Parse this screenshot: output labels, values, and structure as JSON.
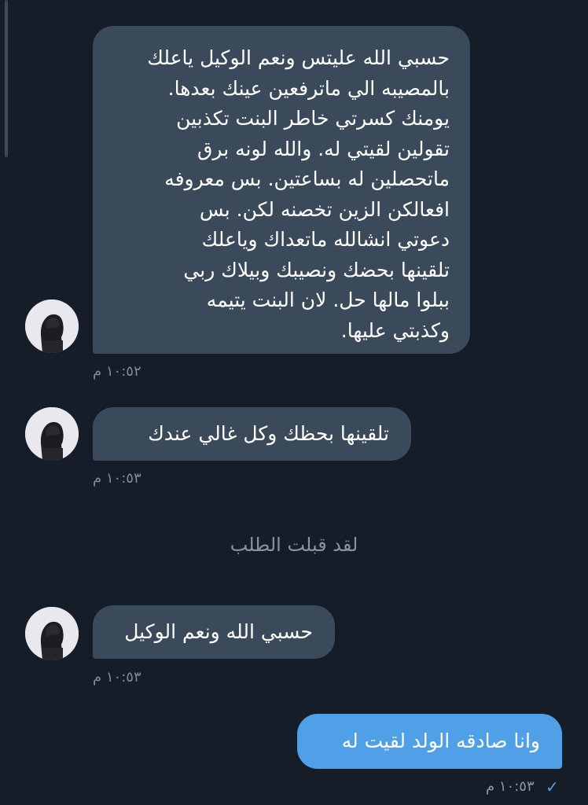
{
  "messages": [
    {
      "direction": "incoming",
      "lines": [
        "حسبي الله عليتس ونعم الوكيل ياعلك",
        "بالمصيبه الي ماترفعين عينك بعدها.",
        "يومنك كسرتي خاطر البنت تكذبين",
        "تقولين لقيتي له. والله لونه برق",
        "ماتحصلين له بساعتين. بس معروفه",
        "افعالكن الزين تخصنه لكن. بس",
        "دعوتي انشالله ماتعداك وياعلك",
        "تلقينها بحضك ونصيبك وبيلاك ربي",
        "ببلوا مالها حل. لان البنت يتيمه",
        "وكذبتي عليها."
      ],
      "time": "١٠:٥٢ م"
    },
    {
      "direction": "incoming",
      "text": "تلقينها بحظك وكل غالي عندك",
      "time": "١٠:٥٣ م"
    },
    {
      "direction": "incoming",
      "text": "حسبي الله ونعم الوكيل",
      "time": "١٠:٥٣ م"
    },
    {
      "direction": "outgoing",
      "text": "وانا صادقه الولد لقيت له",
      "time": "١٠:٥٣ م",
      "status": "✓"
    }
  ],
  "system_note": "لقد قبلت الطلب",
  "colors": {
    "background": "#151d28",
    "incoming_bubble": "#3b4a5b",
    "outgoing_bubble": "#4fa0e6",
    "timestamp": "#7e8b9b",
    "read_check": "#4fa0e6"
  },
  "icons": {
    "avatar": "avatar-icon",
    "sent": "check-icon"
  }
}
